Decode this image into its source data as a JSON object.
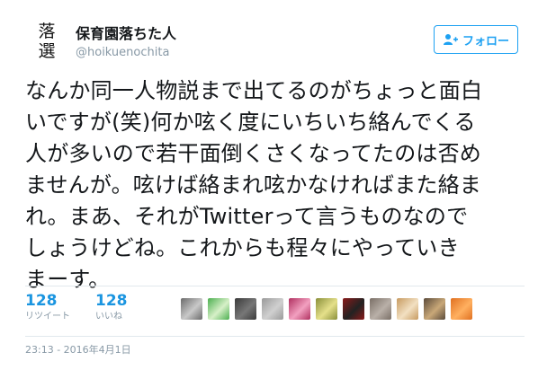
{
  "user": {
    "avatar_lines": [
      "落",
      "選"
    ],
    "full_name": "保育園落ちた人",
    "screen_name": "@hoikuenochita"
  },
  "follow": {
    "label": "フォロー"
  },
  "tweet": {
    "lines": [
      "なんか同一人物説まで出てるのがちょっと面白",
      "いですが(笑)何か呟く度にいちいち絡んでくる",
      "人が多いので若干面倒くさくなってたのは否め",
      "ませんが。呟けば絡まれ呟かなければまた絡ま",
      "れ。まあ、それがTwitterって言うものなので",
      "しょうけどね。これからも程々にやっていき",
      "まーす。"
    ]
  },
  "stats": {
    "retweets": {
      "count": "128",
      "label": "リツイート"
    },
    "likes": {
      "count": "128",
      "label": "いいね"
    }
  },
  "liker_avatars": [
    {
      "name": "liker-avatar-1",
      "colors": [
        "#6b6b6b",
        "#c9c9c9"
      ]
    },
    {
      "name": "liker-avatar-2",
      "colors": [
        "#4caf50",
        "#d7f0c8"
      ]
    },
    {
      "name": "liker-avatar-3",
      "colors": [
        "#3a3a3a",
        "#777777"
      ]
    },
    {
      "name": "liker-avatar-4",
      "colors": [
        "#9a9a9a",
        "#d0d0d0"
      ]
    },
    {
      "name": "liker-avatar-5",
      "colors": [
        "#b03060",
        "#f2a0c0"
      ]
    },
    {
      "name": "liker-avatar-6",
      "colors": [
        "#8a8f3a",
        "#e5e08a"
      ]
    },
    {
      "name": "liker-avatar-7",
      "colors": [
        "#8b1a1a",
        "#222222"
      ]
    },
    {
      "name": "liker-avatar-8",
      "colors": [
        "#7a6f66",
        "#b9b0a8"
      ]
    },
    {
      "name": "liker-avatar-9",
      "colors": [
        "#c79a60",
        "#f2e0c2"
      ]
    },
    {
      "name": "liker-avatar-10",
      "colors": [
        "#5a4a3a",
        "#c9a878"
      ]
    },
    {
      "name": "liker-avatar-11",
      "colors": [
        "#e07020",
        "#ffb060"
      ]
    }
  ],
  "timestamp": "23:13 - 2016年4月1日",
  "colors": {
    "accent": "#1da1f2",
    "link": "#1b95e0",
    "muted": "#8899a6",
    "divider": "#e1e8ed"
  }
}
